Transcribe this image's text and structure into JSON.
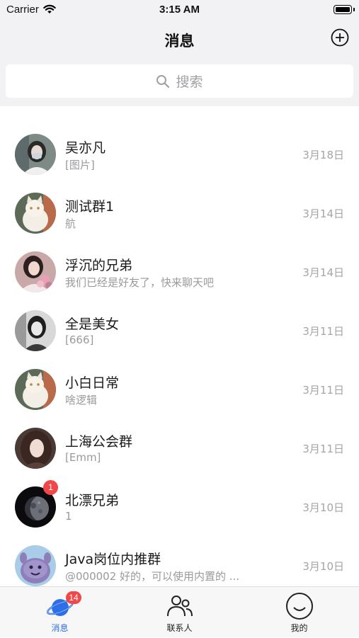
{
  "status_bar": {
    "carrier": "Carrier",
    "time": "3:15 AM"
  },
  "nav": {
    "title": "消息",
    "add_icon": "plus-circle-icon"
  },
  "search": {
    "placeholder": "搜索",
    "icon": "search-icon"
  },
  "chats": [
    {
      "name": "吴亦凡",
      "preview": "[图片]",
      "date": "3月18日",
      "avatar": "avatar-woman-mask"
    },
    {
      "name": "测试群1",
      "preview": "航",
      "date": "3月14日",
      "avatar": "avatar-cat"
    },
    {
      "name": "浮沉的兄弟",
      "preview": "我们已经是好友了，快来聊天吧",
      "date": "3月14日",
      "avatar": "avatar-woman-flowers"
    },
    {
      "name": "全是美女",
      "preview": "[666]",
      "date": "3月11日",
      "avatar": "avatar-woman-bw"
    },
    {
      "name": "小白日常",
      "preview": "啥逻辑",
      "date": "3月11日",
      "avatar": "avatar-cat"
    },
    {
      "name": "上海公会群",
      "preview": "[Emm]",
      "date": "3月11日",
      "avatar": "avatar-woman-hair"
    },
    {
      "name": "北漂兄弟",
      "preview": "1",
      "date": "3月10日",
      "avatar": "avatar-moon",
      "unread": "1"
    },
    {
      "name": "Java岗位内推群",
      "preview": "@000002 好的，可以使用内置的 ...",
      "date": "3月10日",
      "avatar": "avatar-cartoon"
    }
  ],
  "tabs": [
    {
      "label": "消息",
      "icon": "planet-icon",
      "badge": "14",
      "active": true
    },
    {
      "label": "联系人",
      "icon": "contacts-icon"
    },
    {
      "label": "我的",
      "icon": "smile-icon"
    }
  ],
  "colors": {
    "accent": "#2c6fe6",
    "badge": "#f04848",
    "nav_bg": "#f2f2f4"
  }
}
